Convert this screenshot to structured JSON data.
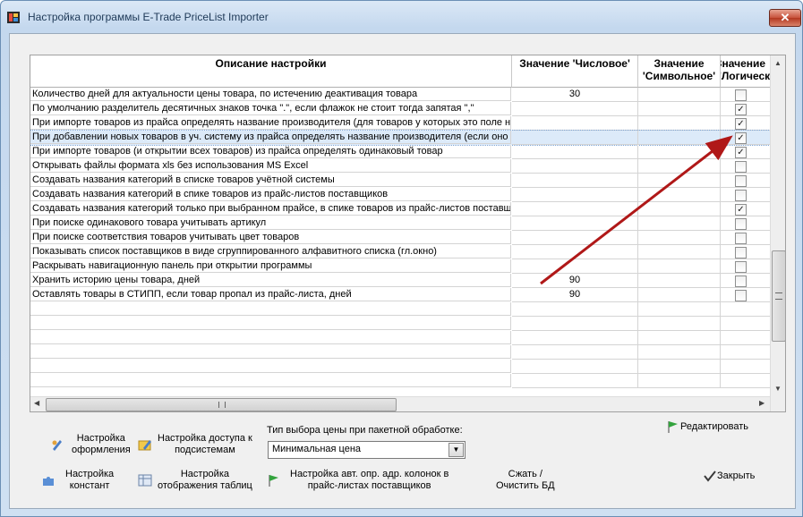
{
  "window": {
    "title": "Настройка программы E-Trade PriceList Importer",
    "close": "✕"
  },
  "grid": {
    "headers": {
      "description": "Описание настройки",
      "numeric": "Значение 'Числовое'",
      "symbolic_1": "Значение",
      "symbolic_2": "'Символьное'",
      "logical_1": "Значение",
      "logical_2": "'Логическое'"
    },
    "rows": [
      {
        "text": "Количество дней для актуальности цены товара, по истечению деактивация товара",
        "num": "30",
        "checked": false
      },
      {
        "text": "По умолчанию разделитель десятичных знаков точка \".\", если флажок не стоит тогда запятая \",\"",
        "num": "",
        "checked": true
      },
      {
        "text": "При импорте товаров из прайса определять название производителя (для товаров у которых это поле не заполнено)",
        "num": "",
        "checked": true
      },
      {
        "text": "При добавлении новых товаров в уч. систему из прайса определять название производителя (если оно не указано)",
        "num": "",
        "checked": true
      },
      {
        "text": "При импорте товаров (и открытии всех товаров) из прайса определять одинаковый товар",
        "num": "",
        "checked": true
      },
      {
        "text": "Открывать файлы формата xls без использования MS Excel",
        "num": "",
        "checked": false
      },
      {
        "text": "Создавать названия категорий в списке товаров учётной системы",
        "num": "",
        "checked": false
      },
      {
        "text": "Создавать названия категорий в спике товаров из прайс-листов поставщиков",
        "num": "",
        "checked": false
      },
      {
        "text": "Создавать названия категорий только при выбранном прайсе, в спике товаров из прайс-листов поставщиков",
        "num": "",
        "checked": true
      },
      {
        "text": "При поиске одинакового товара учитывать артикул",
        "num": "",
        "checked": false
      },
      {
        "text": "При поиске соответствия товаров учитывать цвет товаров",
        "num": "",
        "checked": false
      },
      {
        "text": "Показывать список поставщиков в виде сгруппированного алфавитного списка (гл.окно)",
        "num": "",
        "checked": false
      },
      {
        "text": "Раскрывать навигационную панель при открытии программы",
        "num": "",
        "checked": false
      },
      {
        "text": "Хранить историю цены товара, дней",
        "num": "90",
        "checked": false
      },
      {
        "text": "Оставлять товары в СТИПП, если товар пропал из прайс-листа, дней",
        "num": "90",
        "checked": false
      }
    ]
  },
  "buttons": {
    "look_1": "Настройка",
    "look_2": "оформления",
    "access_1": "Настройка доступа к",
    "access_2": "подсистемам",
    "const_1": "Настройка",
    "const_2": "констант",
    "tables_1": "Настройка",
    "tables_2": "отображения таблиц",
    "columns_1": "Настройка авт. опр. адр. колонок в",
    "columns_2": "прайс-листах поставщиков",
    "compress_1": "Сжать /",
    "compress_2": "Очистить БД",
    "edit": "Редактировать",
    "close": "Закрыть"
  },
  "price_type": {
    "label": "Тип выбора цены при пакетной обработке:",
    "value": "Минимальная цена"
  },
  "colors": {
    "selected_row": "#dceaf9",
    "arrow": "#b01818",
    "accent": "#1e3957"
  }
}
